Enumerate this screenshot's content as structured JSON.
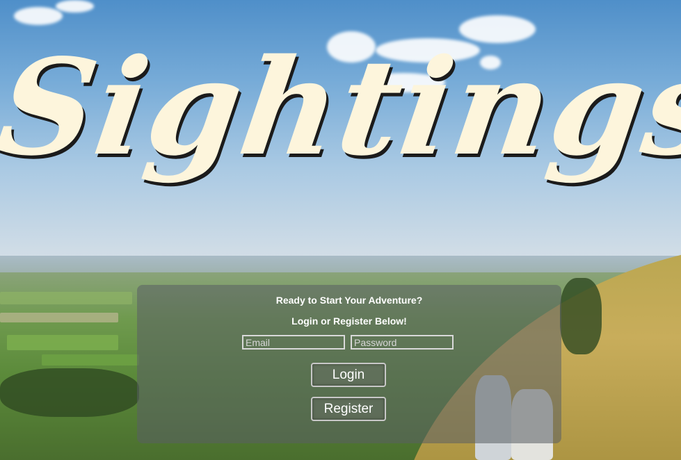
{
  "app": {
    "title": "Sightings"
  },
  "login_panel": {
    "heading": "Ready to Start Your Adventure?",
    "subheading": "Login or Register Below!",
    "email_placeholder": "Email",
    "password_placeholder": "Password",
    "login_label": "Login",
    "register_label": "Register"
  },
  "colors": {
    "title_fill": "#fdf5dc",
    "title_shadow": "#1b1b1b",
    "panel_bg": "rgba(90, 95, 100, 0.55)",
    "text": "#ffffff"
  }
}
